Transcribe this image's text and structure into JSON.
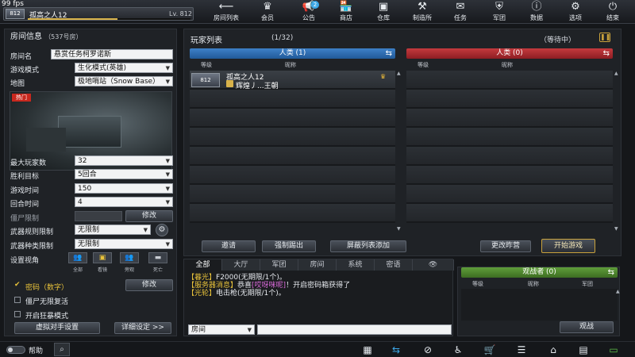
{
  "fps": "99 fps",
  "player": {
    "rank": "812",
    "name": "孤高之人12",
    "level": "Lv. 812",
    "level_fraction": 0.55
  },
  "nav": [
    {
      "label": "房间列表",
      "icon": "back-arrow-icon",
      "glyph": "⟵"
    },
    {
      "label": "会员",
      "icon": "crown-icon",
      "glyph": "♛"
    },
    {
      "label": "公告",
      "icon": "megaphone-icon",
      "glyph": "📢",
      "badge": "2"
    },
    {
      "label": "商店",
      "icon": "shop-icon",
      "glyph": "🏪"
    },
    {
      "label": "仓库",
      "icon": "warehouse-icon",
      "glyph": "▣"
    },
    {
      "label": "制造所",
      "icon": "factory-icon",
      "glyph": "⚒"
    },
    {
      "label": "任务",
      "icon": "mission-icon",
      "glyph": "✉"
    },
    {
      "label": "军团",
      "icon": "legion-icon",
      "glyph": "⛨"
    },
    {
      "label": "数据",
      "icon": "info-icon",
      "glyph": "ⓘ"
    },
    {
      "label": "选项",
      "icon": "gear-icon",
      "glyph": "⚙"
    },
    {
      "label": "结束",
      "icon": "power-icon",
      "glyph": "⏻"
    }
  ],
  "room": {
    "header": "房间信息",
    "number": "（537号房）",
    "name_label": "房间名",
    "name_value": "悬赏任务柯罗诺斯",
    "mode_label": "游戏模式",
    "mode_value": "生化模式(英雄)",
    "map_label": "地图",
    "map_value": "极地哨站（Snow Base）",
    "hot_tag": "热门",
    "max_players_label": "最大玩家数",
    "max_players_value": "32",
    "win_target_label": "胜利目标",
    "win_target_value": "5回合",
    "game_time_label": "游戏时间",
    "game_time_value": "150",
    "round_time_label": "回合时间",
    "round_time_value": "4",
    "zombie_limit_label": "僵尸限制",
    "edit_label": "修改",
    "weapon_rule_label": "武器规则限制",
    "weapon_rule_value": "无限制",
    "weapon_type_label": "武器种类限制",
    "weapon_type_value": "无限制",
    "view_label": "设置视角",
    "views": [
      "全部",
      "看镜",
      "旁观",
      "死亡"
    ],
    "password_label": "密码（数字）",
    "password_edit": "修改",
    "zombie_revive_label": "僵尸无限复活",
    "berserk_label": "开启狂暴模式",
    "virtual_opponent_button": "虚拟对手设置",
    "detail_settings_button": "详细设定 >>"
  },
  "playerlist": {
    "title": "玩家列表",
    "count": "(1/32)",
    "status": "（等待中）",
    "team_a": "人类  (1)",
    "team_b": "人类  (0)",
    "col_rank": "等级",
    "col_name": "昵称",
    "players": [
      {
        "rank": "812",
        "name": "孤高之人12",
        "clan": "辉煌丿...王朝"
      }
    ],
    "invite_button": "邀请",
    "kick_button": "强制踢出",
    "block_button": "屏蔽列表添加",
    "change_time_button": "更改昨营",
    "start_button": "开始游戏"
  },
  "chat": {
    "tabs": [
      "全部",
      "大厅",
      "军团",
      "房间",
      "系统",
      "密语"
    ],
    "lines": [
      [
        {
          "t": "【暮光】",
          "c": "#e8c23a"
        },
        {
          "t": "F2000(无期限/1个)。",
          "c": "#e6e9ee"
        }
      ],
      [
        {
          "t": "【服务器消息】",
          "c": "#e8c23a"
        },
        {
          "t": "恭喜",
          "c": "#e6e9ee"
        },
        {
          "t": "[哎呀咪呢]",
          "c": "#d86ad8"
        },
        {
          "t": "！开启密码箱获得了",
          "c": "#e6e9ee"
        }
      ],
      [
        {
          "t": "【光轮】",
          "c": "#e8c23a"
        },
        {
          "t": "电击枪(无期限/1个)。",
          "c": "#e6e9ee"
        }
      ]
    ],
    "channel": "房间"
  },
  "spectator": {
    "header": "观战者  (0)",
    "col_rank": "等级",
    "col_name": "昵称",
    "col_legion": "军团",
    "watch_button": "观战"
  },
  "bottom": {
    "help_label": "帮助",
    "icons": [
      "calendar-icon",
      "swap-icon",
      "compass-icon",
      "run-icon",
      "cart-icon",
      "list-icon",
      "home-icon",
      "check-calendar-icon",
      "battery-icon"
    ]
  },
  "colors": {
    "team_a": "#2f6cb0",
    "team_b": "#b0262b",
    "start_border": "#c9a23c",
    "spectator": "#4f8a2f"
  }
}
